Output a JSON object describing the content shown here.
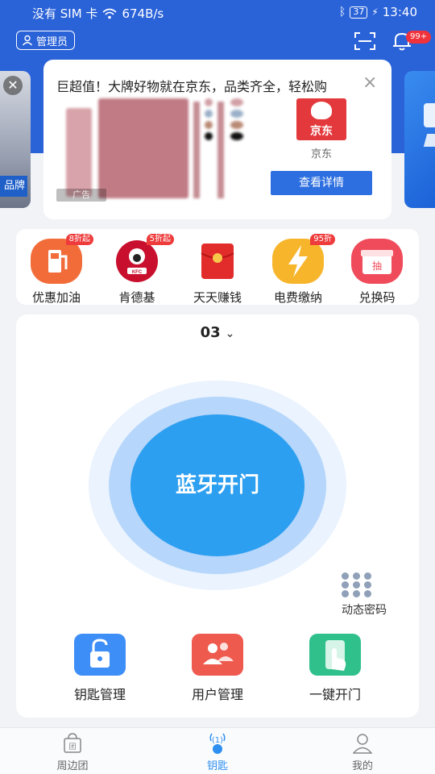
{
  "status_bar": {
    "carrier": "没有 SIM 卡",
    "speed": "674B/s",
    "battery": "37",
    "time": "13:40"
  },
  "header": {
    "role_label": "管理员",
    "notification_badge": "99+"
  },
  "ad": {
    "left_card_tag": "品牌",
    "title": "巨超值！大牌好物就在京东，品类齐全，轻松购",
    "label": "广告",
    "brand_logo_text": "京东",
    "brand_name": "京东",
    "cta": "查看详情"
  },
  "services": [
    {
      "label": "优惠加油",
      "tag": "8折起",
      "color": "#f26c3a"
    },
    {
      "label": "肯德基",
      "tag": "5折起",
      "color": "#c8102e"
    },
    {
      "label": "天天赚钱",
      "tag": "",
      "color": "#e22c2c"
    },
    {
      "label": "电费缴纳",
      "tag": "95折",
      "color": "#f7b52b"
    },
    {
      "label": "兑换码",
      "tag": "",
      "color": "#ef4b5a"
    }
  ],
  "main": {
    "unit": "03",
    "bluetooth_button": "蓝牙开门",
    "dynamic_password": "动态密码",
    "actions": [
      {
        "label": "钥匙管理",
        "color": "#3e8ef7"
      },
      {
        "label": "用户管理",
        "color": "#ef5a4f"
      },
      {
        "label": "一键开门",
        "color": "#2fc08c"
      }
    ]
  },
  "tabs": [
    {
      "label": "周边团",
      "active": false
    },
    {
      "label": "钥匙",
      "active": true
    },
    {
      "label": "我的",
      "active": false
    }
  ],
  "colors": {
    "brand_blue": "#2a62d8",
    "accent_blue": "#2d9ff0"
  }
}
